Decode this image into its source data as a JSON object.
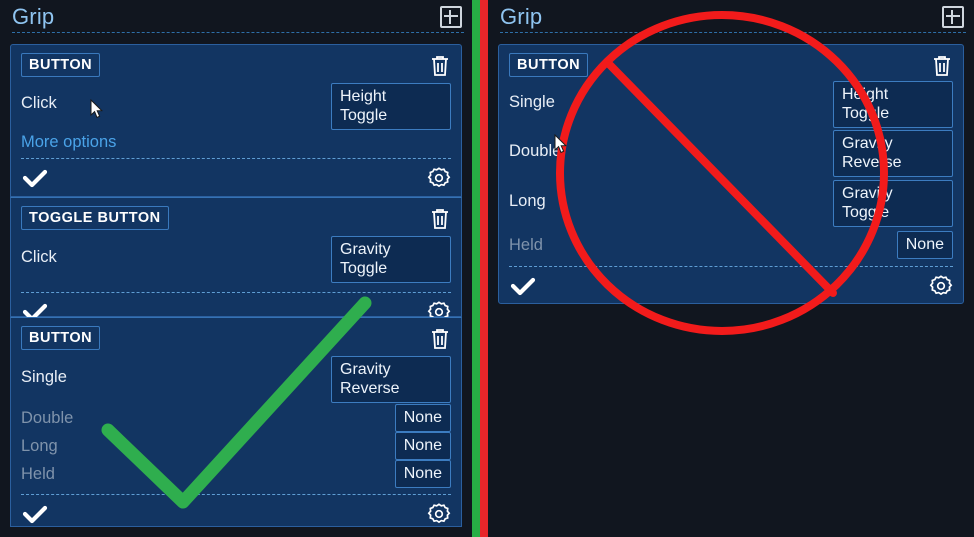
{
  "left_panel": {
    "header": {
      "title": "Grip",
      "add_icon": "add-square-icon"
    },
    "cards": [
      {
        "tag": "BUTTON",
        "delete_icon": "trash-icon",
        "settings_icon": "gear-icon",
        "enabled_icon": "check-icon",
        "rows": [
          {
            "label": "Click",
            "value": "Height\nToggle",
            "value_line1": "Height",
            "value_line2": "Toggle",
            "dim": false
          }
        ],
        "more_options": "More options"
      },
      {
        "tag": "TOGGLE BUTTON",
        "delete_icon": "trash-icon",
        "settings_icon": "gear-icon",
        "enabled_icon": "check-icon",
        "rows": [
          {
            "label": "Click",
            "value_line1": "Gravity",
            "value_line2": "Toggle",
            "dim": false
          }
        ]
      },
      {
        "tag": "BUTTON",
        "delete_icon": "trash-icon",
        "settings_icon": "gear-icon",
        "enabled_icon": "check-icon",
        "rows": [
          {
            "label": "Single",
            "value_line1": "Gravity",
            "value_line2": "Reverse",
            "dim": false
          },
          {
            "label": "Double",
            "value_line1": "None",
            "value_line2": "",
            "dim": true
          },
          {
            "label": "Long",
            "value_line1": "None",
            "value_line2": "",
            "dim": true
          },
          {
            "label": "Held",
            "value_line1": "None",
            "value_line2": "",
            "dim": true
          }
        ]
      }
    ]
  },
  "right_panel": {
    "header": {
      "title": "Grip",
      "add_icon": "add-square-icon"
    },
    "cards": [
      {
        "tag": "BUTTON",
        "delete_icon": "trash-icon",
        "settings_icon": "gear-icon",
        "enabled_icon": "check-icon",
        "rows": [
          {
            "label": "Single",
            "value_line1": "Height",
            "value_line2": "Toggle",
            "dim": false
          },
          {
            "label": "Double",
            "value_line1": "Gravity",
            "value_line2": "Reverse",
            "dim": false
          },
          {
            "label": "Long",
            "value_line1": "Gravity",
            "value_line2": "Toggle",
            "dim": false
          },
          {
            "label": "Held",
            "value_line1": "None",
            "value_line2": "",
            "dim": true
          }
        ]
      }
    ]
  },
  "annotations": {
    "checkmark_stroke": "#2fae4e",
    "prohibition_stroke": "#f21b1b",
    "divider_green": "#27ae45",
    "divider_red": "#e8262a"
  },
  "colors": {
    "background": "#11161f",
    "card_bg": "#123562",
    "card_border": "#2b5f9e",
    "chip_bg": "#0d2b52",
    "chip_border": "#3c7cc0",
    "title": "#8fc4f0",
    "link": "#4aa3e8",
    "label": "#e8eef6",
    "label_dim": "#7f93ab"
  }
}
